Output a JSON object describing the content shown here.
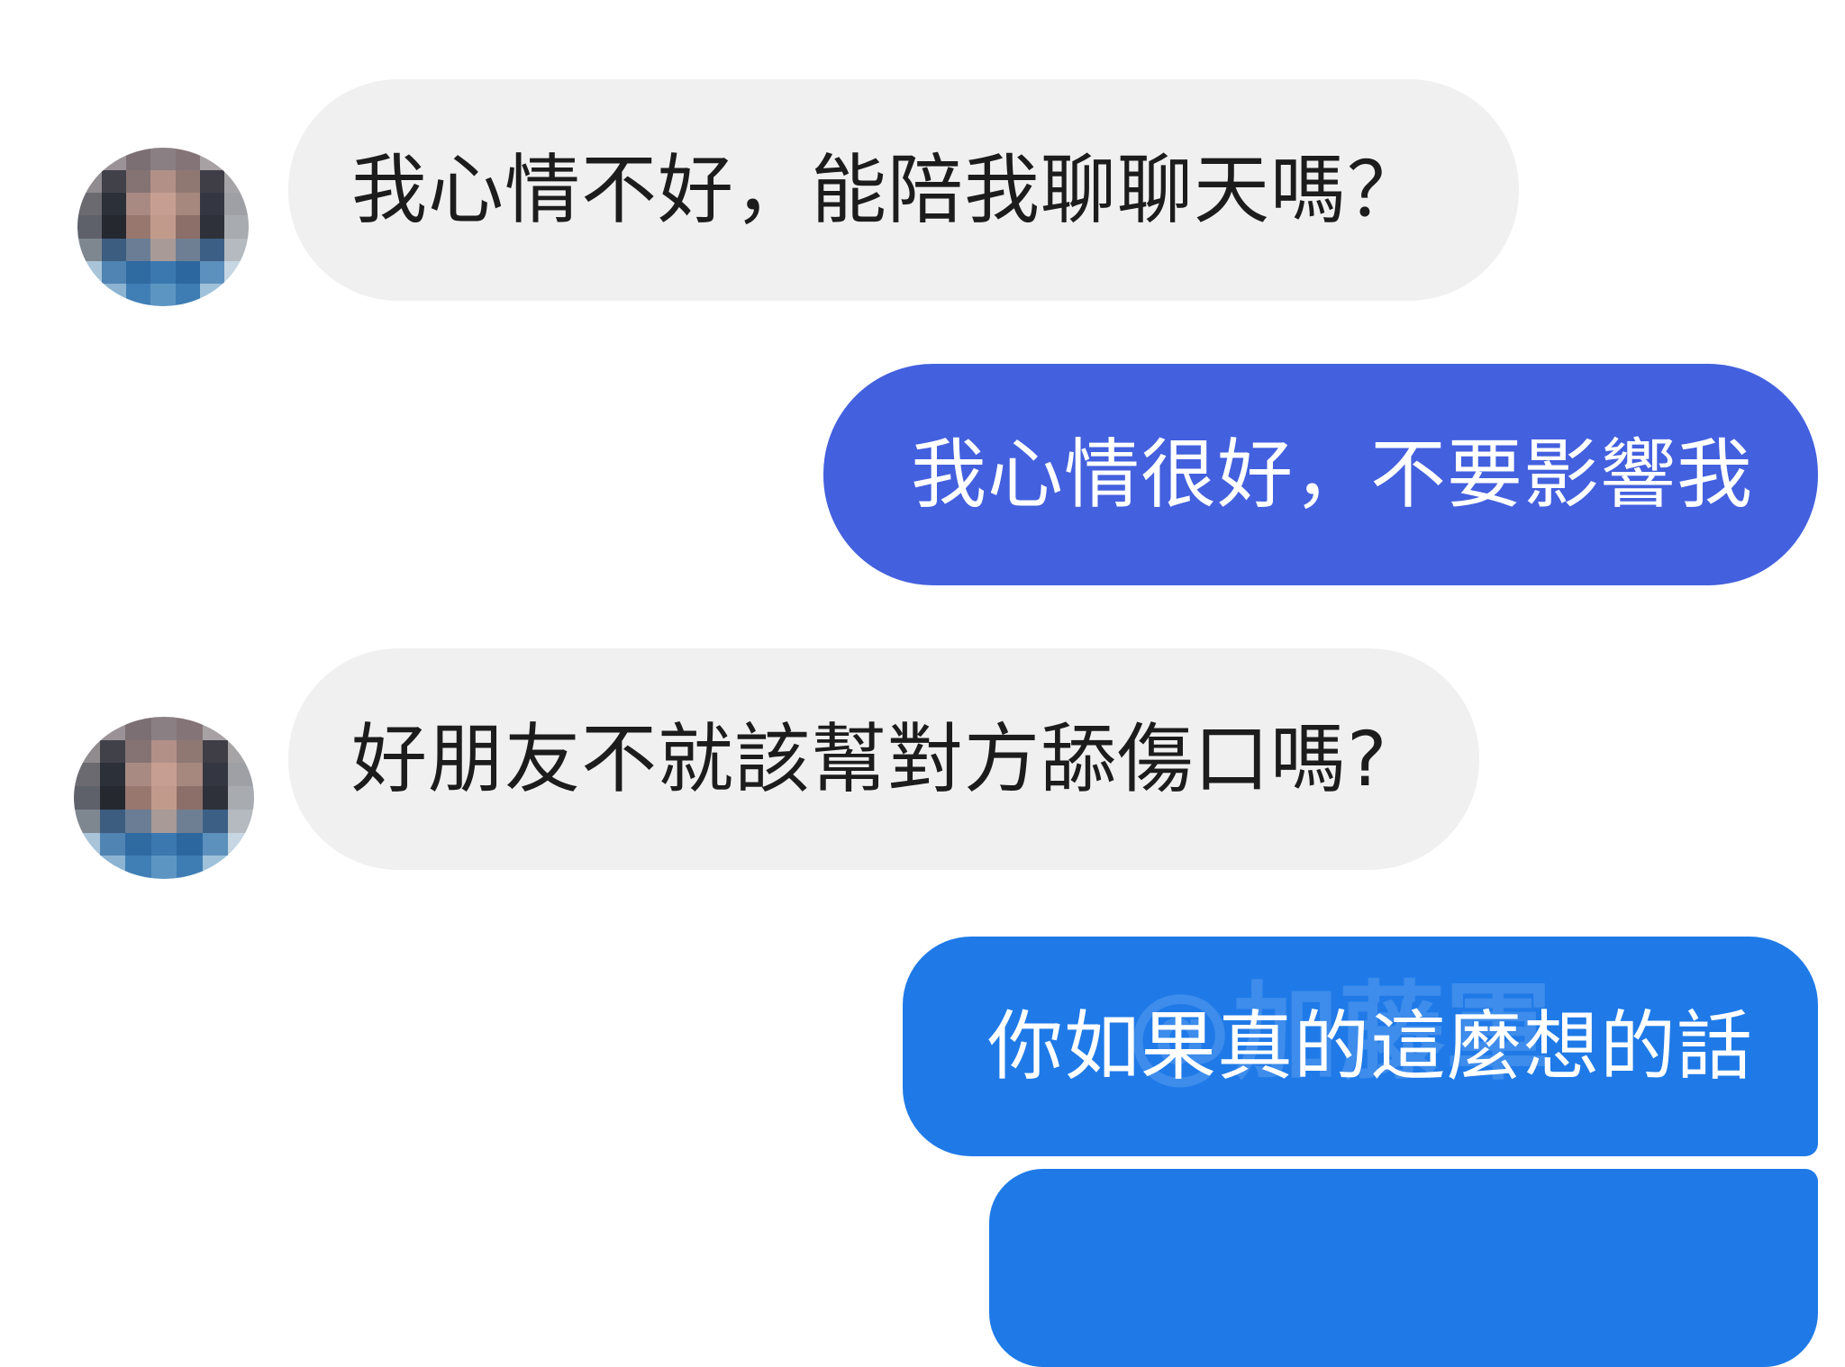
{
  "watermark_text": "@加藤軍",
  "colors": {
    "incoming_bubble": "#f0f0f0",
    "incoming_text": "#1c1c1c",
    "outgoing_bubble_purple": "#4360de",
    "outgoing_bubble_blue": "#1f7ae8",
    "outgoing_text": "#ffffff"
  },
  "messages": [
    {
      "sender": "other",
      "text": "我心情不好，能陪我聊聊天嗎？"
    },
    {
      "sender": "me",
      "text": "我心情很好，不要影響我"
    },
    {
      "sender": "other",
      "text": "好朋友不就該幫對方舔傷口嗎?"
    },
    {
      "sender": "me",
      "text": "你如果真的這麼想的話"
    },
    {
      "sender": "me",
      "text": ""
    }
  ],
  "avatar": {
    "icon": "pixelated-profile-avatar"
  }
}
